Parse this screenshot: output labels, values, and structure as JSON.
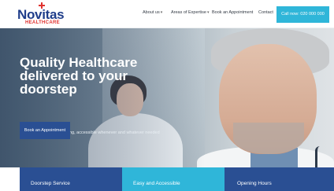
{
  "header": {
    "logo": {
      "name": "Novitas",
      "sub": "HEALTHCARE"
    },
    "nav": [
      {
        "label": "About us",
        "has_dropdown": true
      },
      {
        "label": "Areas of Expertise",
        "has_dropdown": true
      },
      {
        "label": "Book an Appointment",
        "has_dropdown": false
      },
      {
        "label": "Contact",
        "has_dropdown": false
      }
    ],
    "call_button": "Call now: 020 000 000",
    "chevron": "▾"
  },
  "hero": {
    "title_lines": [
      "Quality Healthcare",
      "delivered to your",
      "doorstep"
    ],
    "subtitle": "Quality healthcare and living, accessible whenever and whatever needed",
    "cta": "Book an Appointment"
  },
  "tiles": [
    {
      "label": "Doorstep Service"
    },
    {
      "label": "Easy and Accessible"
    },
    {
      "label": "Opening Hours"
    }
  ],
  "colors": {
    "brand_blue": "#2a4f93",
    "accent_cyan": "#2fb6d9",
    "logo_red": "#e0322f"
  }
}
